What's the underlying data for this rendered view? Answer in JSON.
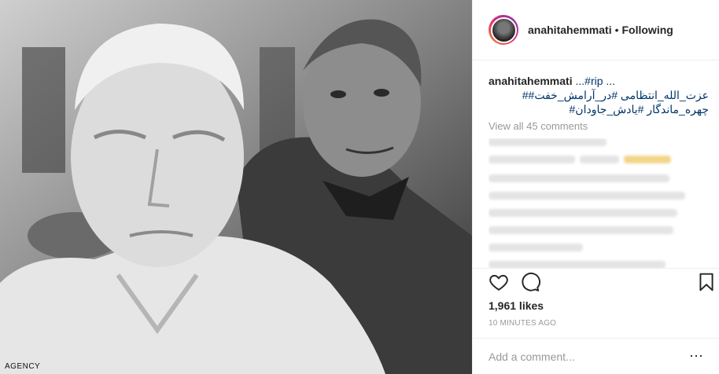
{
  "post": {
    "username": "anahitahemmati",
    "separator": "•",
    "follow_status": "Following"
  },
  "caption": {
    "username": "anahitahemmati",
    "first_line": "...#rip ...",
    "line2": "عزت_الله_انتظامی #در_آرامش_خفت##",
    "line3": "چهره_ماندگار #یادش_جاودان#"
  },
  "comments": {
    "view_all": "View all 45 comments"
  },
  "stats": {
    "likes": "1,961 likes",
    "time": "10 MINUTES AGO"
  },
  "composer": {
    "placeholder": "Add a comment..."
  },
  "photo": {
    "watermark": "AGENCY"
  },
  "icons": {
    "like": "heart-icon",
    "comment": "comment-icon",
    "save": "bookmark-icon",
    "more": "more-options-icon"
  }
}
